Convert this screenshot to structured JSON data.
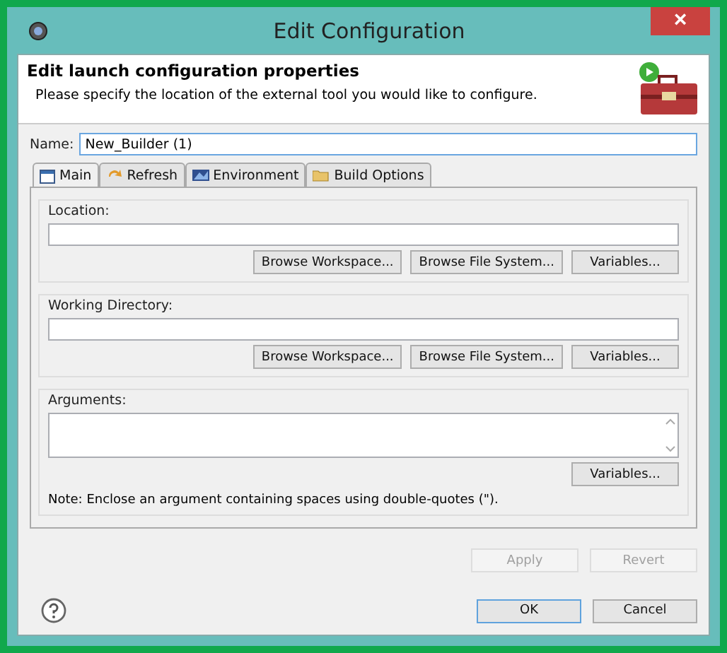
{
  "window": {
    "title": "Edit Configuration",
    "close": "×"
  },
  "header": {
    "title": "Edit launch configuration properties",
    "message": "Please specify the location of the external tool you would like to configure."
  },
  "name_field": {
    "label": "Name:",
    "value": "New_Builder (1)"
  },
  "tabs": [
    {
      "label": "Main",
      "kind": "main",
      "selected": true
    },
    {
      "label": "Refresh",
      "kind": "refresh",
      "selected": false
    },
    {
      "label": "Environment",
      "kind": "environment",
      "selected": false
    },
    {
      "label": "Build Options",
      "kind": "folder",
      "selected": false
    }
  ],
  "groups": [
    {
      "label": "Location:",
      "kind": "line",
      "buttons": [
        "Browse Workspace...",
        "Browse File System...",
        "Variables..."
      ]
    },
    {
      "label": "Working Directory:",
      "kind": "line",
      "buttons": [
        "Browse Workspace...",
        "Browse File System...",
        "Variables..."
      ]
    },
    {
      "label": "Arguments:",
      "kind": "area",
      "buttons": [
        "Variables..."
      ],
      "note": "Note: Enclose an argument containing spaces using double-quotes (\")."
    }
  ],
  "panel_buttons": [
    {
      "label": "Apply",
      "disabled": true
    },
    {
      "label": "Revert",
      "disabled": true
    }
  ],
  "dialog_buttons": [
    {
      "label": "OK",
      "default": true
    },
    {
      "label": "Cancel",
      "default": false
    }
  ]
}
